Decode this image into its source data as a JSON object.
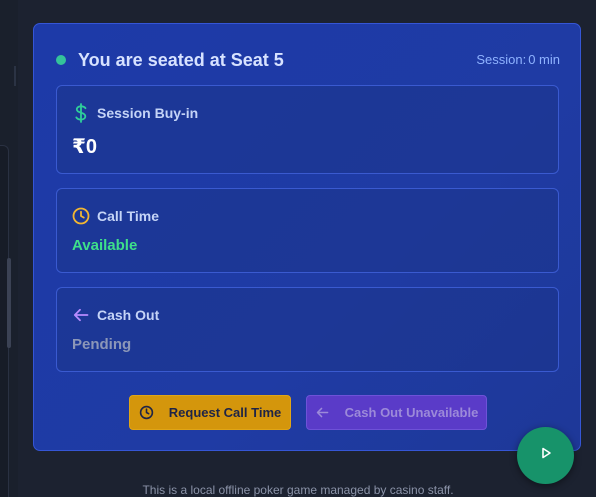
{
  "seat": {
    "status_text": "You are seated at Seat 5",
    "session_label": "Session:",
    "session_value": "0 min"
  },
  "buyin": {
    "icon": "dollar-icon",
    "label": "Session Buy-in",
    "value": "₹0"
  },
  "call_time": {
    "icon": "clock-icon",
    "label": "Call Time",
    "value": "Available"
  },
  "cash_out": {
    "icon": "arrow-left-icon",
    "label": "Cash Out",
    "value": "Pending"
  },
  "actions": {
    "request_call_time": "Request Call Time",
    "cash_out_unavailable": "Cash Out Unavailable"
  },
  "fab": {
    "icon": "play-icon"
  },
  "footer": {
    "note": "This is a local offline poker game managed by casino staff."
  },
  "colors": {
    "card_bg": "#1d3aa8",
    "status_dot": "#34c39a",
    "available": "#3ee08a",
    "call_button": "#d4960c",
    "cash_button": "#5a3bc8",
    "fab": "#17936a"
  }
}
